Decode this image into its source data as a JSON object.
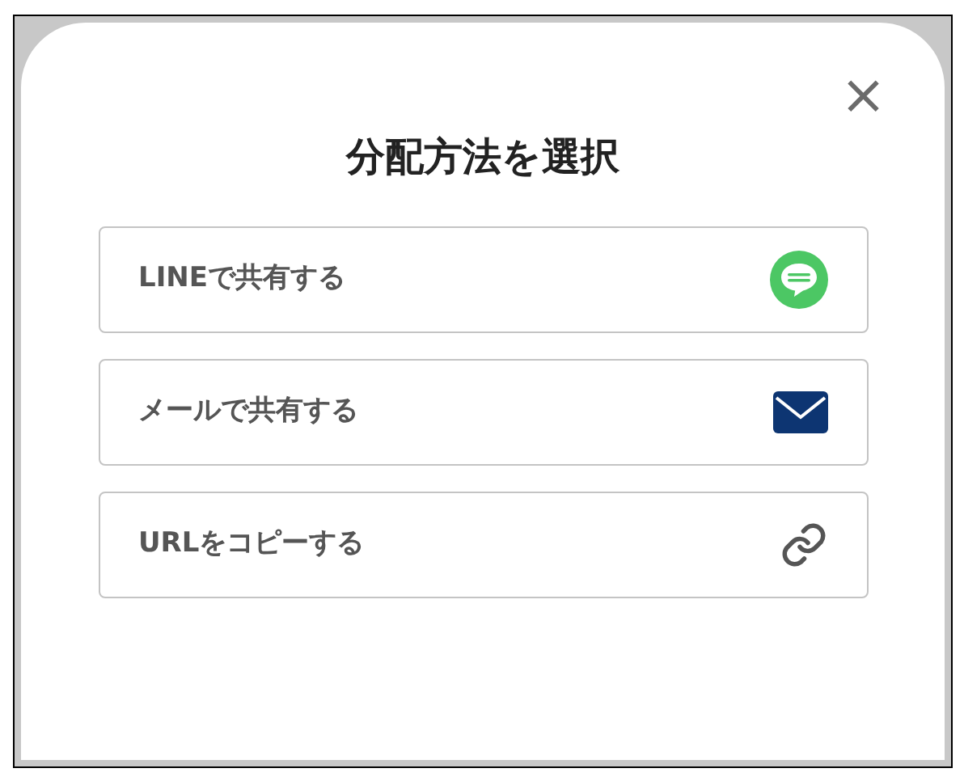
{
  "dialog": {
    "title": "分配方法を選択",
    "close": "×",
    "options": [
      {
        "kind": "line",
        "label": "LINEで共有する"
      },
      {
        "kind": "mail",
        "label": "メールで共有する"
      },
      {
        "kind": "link",
        "label": "URLをコピーする"
      }
    ]
  }
}
